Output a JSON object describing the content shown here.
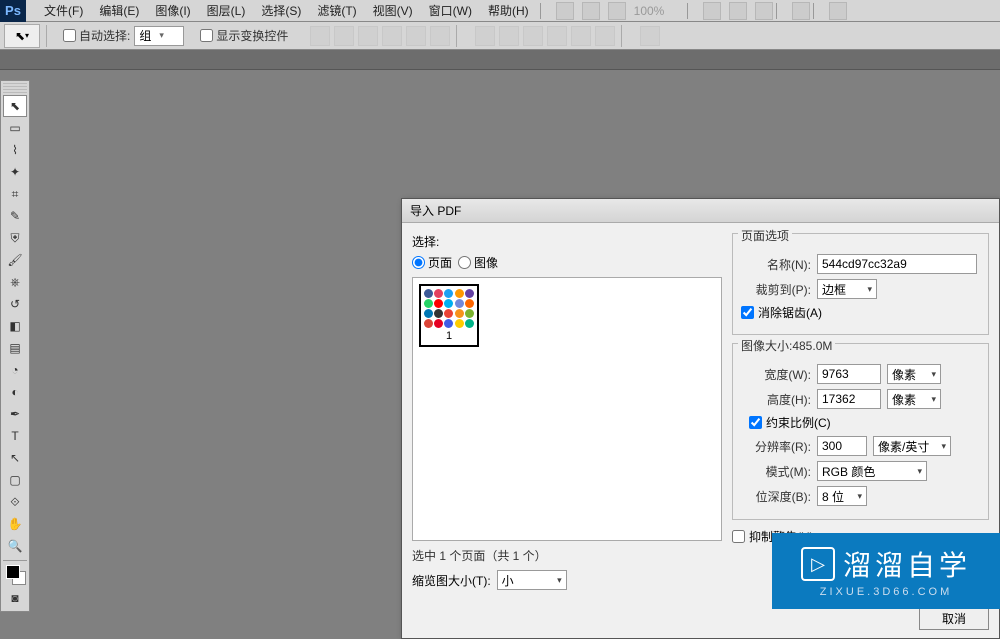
{
  "menubar": {
    "items": [
      "文件(F)",
      "编辑(E)",
      "图像(I)",
      "图层(L)",
      "选择(S)",
      "滤镜(T)",
      "视图(V)",
      "窗口(W)",
      "帮助(H)"
    ]
  },
  "optionsbar": {
    "auto_select_label": "自动选择:",
    "auto_select_value": "组",
    "show_transform_label": "显示变换控件"
  },
  "dialog": {
    "title": "导入 PDF",
    "select_legend": "选择:",
    "radio_page": "页面",
    "radio_image": "图像",
    "thumb_number": "1",
    "selected_info": "选中 1 个页面（共 1 个）",
    "thumb_size_label": "缩览图大小(T):",
    "thumb_size_value": "小",
    "page_options_legend": "页面选项",
    "name_label": "名称(N):",
    "name_value": "544cd97cc32a9",
    "crop_label": "裁剪到(P):",
    "crop_value": "边框",
    "antialias_label": "消除锯齿(A)",
    "image_size_legend": "图像大小:485.0M",
    "width_label": "宽度(W):",
    "width_value": "9763",
    "width_unit": "像素",
    "height_label": "高度(H):",
    "height_value": "17362",
    "height_unit": "像素",
    "constrain_label": "约束比例(C)",
    "resolution_label": "分辨率(R):",
    "resolution_value": "300",
    "resolution_unit": "像素/英寸",
    "mode_label": "模式(M):",
    "mode_value": "RGB 颜色",
    "depth_label": "位深度(B):",
    "depth_value": "8 位",
    "suppress_label": "抑制警告(U)",
    "cancel_btn": "取消"
  },
  "watermark": {
    "text": "溜溜自学",
    "sub": "ZIXUE.3D66.COM"
  },
  "thumb_colors": [
    "#3b5998",
    "#e4405f",
    "#1da1f2",
    "#ff9900",
    "#6441a5",
    "#25d366",
    "#ff0000",
    "#00aff0",
    "#7289da",
    "#ff6600",
    "#0077b5",
    "#333",
    "#ea4335",
    "#f7931a",
    "#7bb32e",
    "#db4437",
    "#e60023",
    "#405de6",
    "#ffcc00",
    "#00b489"
  ]
}
